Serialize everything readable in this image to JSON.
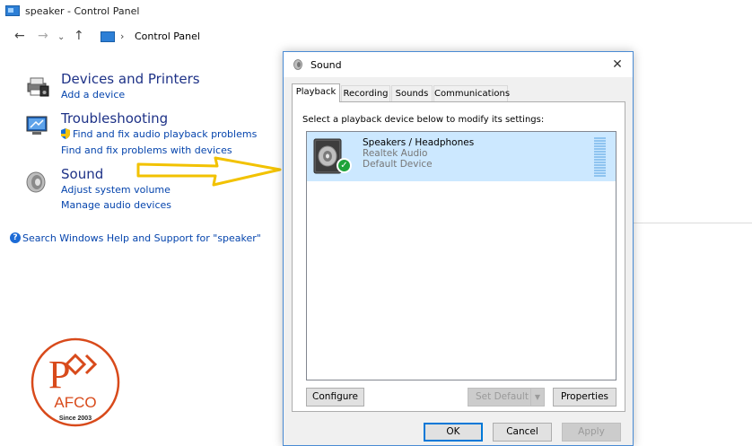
{
  "window": {
    "title": "speaker - Control Panel"
  },
  "address_bar": {
    "back_glyph": "←",
    "forward_glyph": "→",
    "recent_glyph": "⌄",
    "up_glyph": "↑",
    "separator": "›",
    "path": "Control Panel"
  },
  "results": {
    "devices": {
      "title": "Devices and Printers",
      "links": [
        "Add a device"
      ],
      "icon": "printer-icon"
    },
    "troubleshooting": {
      "title": "Troubleshooting",
      "links": [
        "Find and fix audio playback problems",
        "Find and fix problems with devices"
      ],
      "icon": "troubleshooting-icon"
    },
    "sound": {
      "title": "Sound",
      "links": [
        "Adjust system volume",
        "Manage audio devices"
      ],
      "icon": "speaker-icon"
    },
    "help_text": "Search Windows Help and Support for \"speaker\""
  },
  "logo": {
    "letters": "AFCO",
    "initial": "P",
    "since": "Since 2003",
    "color": "#d84a1b"
  },
  "dialog": {
    "title": "Sound",
    "close_glyph": "✕",
    "tabs": [
      "Playback",
      "Recording",
      "Sounds",
      "Communications"
    ],
    "active_tab": "Playback",
    "instruction": "Select a playback device below to modify its settings:",
    "devices": [
      {
        "name": "Speakers / Headphones",
        "driver": "Realtek Audio",
        "status": "Default Device",
        "selected": true
      }
    ],
    "buttons": {
      "configure": "Configure",
      "set_default": "Set Default",
      "set_default_arrow": "▼",
      "properties": "Properties",
      "ok": "OK",
      "cancel": "Cancel",
      "apply": "Apply"
    }
  },
  "colors": {
    "link": "#0645ad",
    "heading": "#1e3287",
    "selection": "#cce8ff",
    "arrow": "#f2c200"
  }
}
